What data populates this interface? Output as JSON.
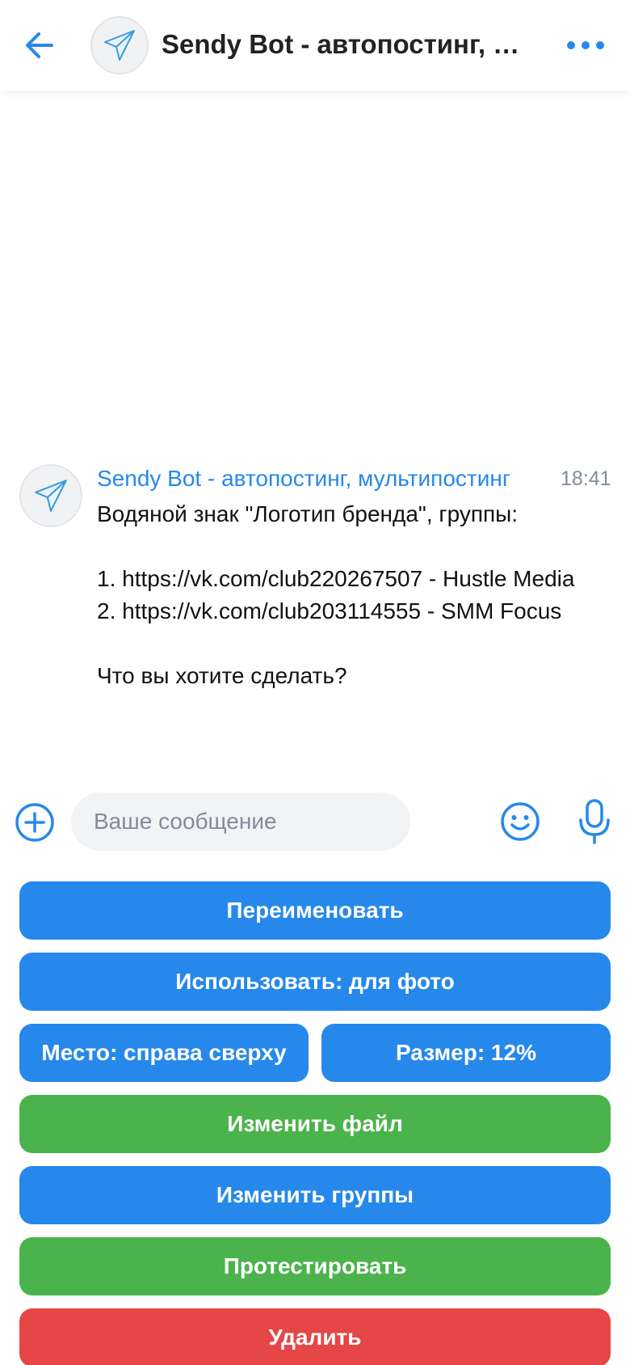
{
  "header": {
    "title": "Sendy Bot - автопостинг, мультипостинг"
  },
  "message": {
    "sender": "Sendy Bot - автопостинг, мультипостинг",
    "time": "18:41",
    "lines": [
      "Водяной знак \"Логотип бренда\", группы:",
      "",
      "1. https://vk.com/club220267507 - Hustle Media",
      "2. https://vk.com/club203114555 - SMM Focus",
      "",
      "Что вы хотите сделать?"
    ]
  },
  "composer": {
    "placeholder": "Ваше сообщение"
  },
  "keyboard": {
    "rename": "Переименовать",
    "use_for": "Использовать: для фото",
    "position": "Место: справа сверху",
    "size": "Размер: 12%",
    "change_file": "Изменить файл",
    "change_groups": "Изменить группы",
    "test": "Протестировать",
    "delete": "Удалить"
  },
  "colors": {
    "accent": "#2688eb",
    "button_blue": "#2688eb",
    "button_green": "#4bb34b",
    "button_red": "#e64646",
    "muted": "#818c99"
  },
  "icons": {
    "back": "arrow-left-icon",
    "more": "more-horizontal-icon",
    "avatar": "paper-plane-icon",
    "attach": "add-circle-icon",
    "emoji": "smile-icon",
    "mic": "microphone-icon"
  }
}
